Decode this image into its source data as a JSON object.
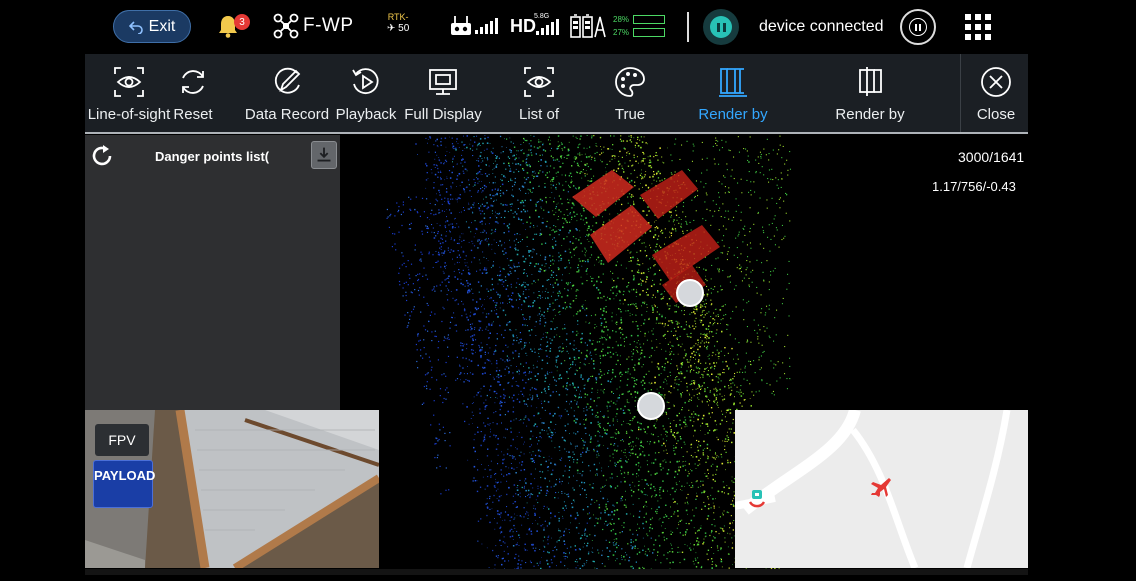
{
  "status_bar": {
    "exit_label": "Exit",
    "notification_count": "3",
    "aircraft_model": "F-WP",
    "rtk_label": "RTK-",
    "rtk_value": "50",
    "video_link": "HD",
    "video_band": "5.8G",
    "battery_1_percent": "28%",
    "battery_2_percent": "27%",
    "device_status": "device connected"
  },
  "toolbar": {
    "items": [
      {
        "label": "Line-of-sight",
        "icon": "eye-scan-icon"
      },
      {
        "label": "Reset",
        "icon": "reset-icon"
      },
      {
        "label": "Data Record",
        "icon": "record-pen-icon"
      },
      {
        "label": "Playback",
        "icon": "playback-icon"
      },
      {
        "label": "Full Display",
        "icon": "full-display-icon"
      },
      {
        "label": "List of",
        "icon": "list-eye-icon"
      },
      {
        "label": "True",
        "icon": "palette-icon"
      },
      {
        "label": "Render by",
        "icon": "render-height-icon"
      },
      {
        "label": "Render by",
        "icon": "render-intensity-icon"
      },
      {
        "label": "Close",
        "icon": "close-circle-icon"
      }
    ],
    "active_index": 7
  },
  "danger_panel": {
    "title": "Danger points list("
  },
  "point_cloud": {
    "resolution_readout": "3000/1641",
    "coordinate_readout": "1.17/756/-0.43"
  },
  "camera": {
    "fpv_label": "FPV",
    "payload_label": "PAYLOAD"
  },
  "colors": {
    "accent": "#33a7ff",
    "teal": "#28c2b6",
    "exit_bg": "#1b3a63",
    "payload_bg": "#1a3ea6",
    "toolbar_bg": "#1b1f24",
    "panel_bg": "#2e2f31"
  }
}
